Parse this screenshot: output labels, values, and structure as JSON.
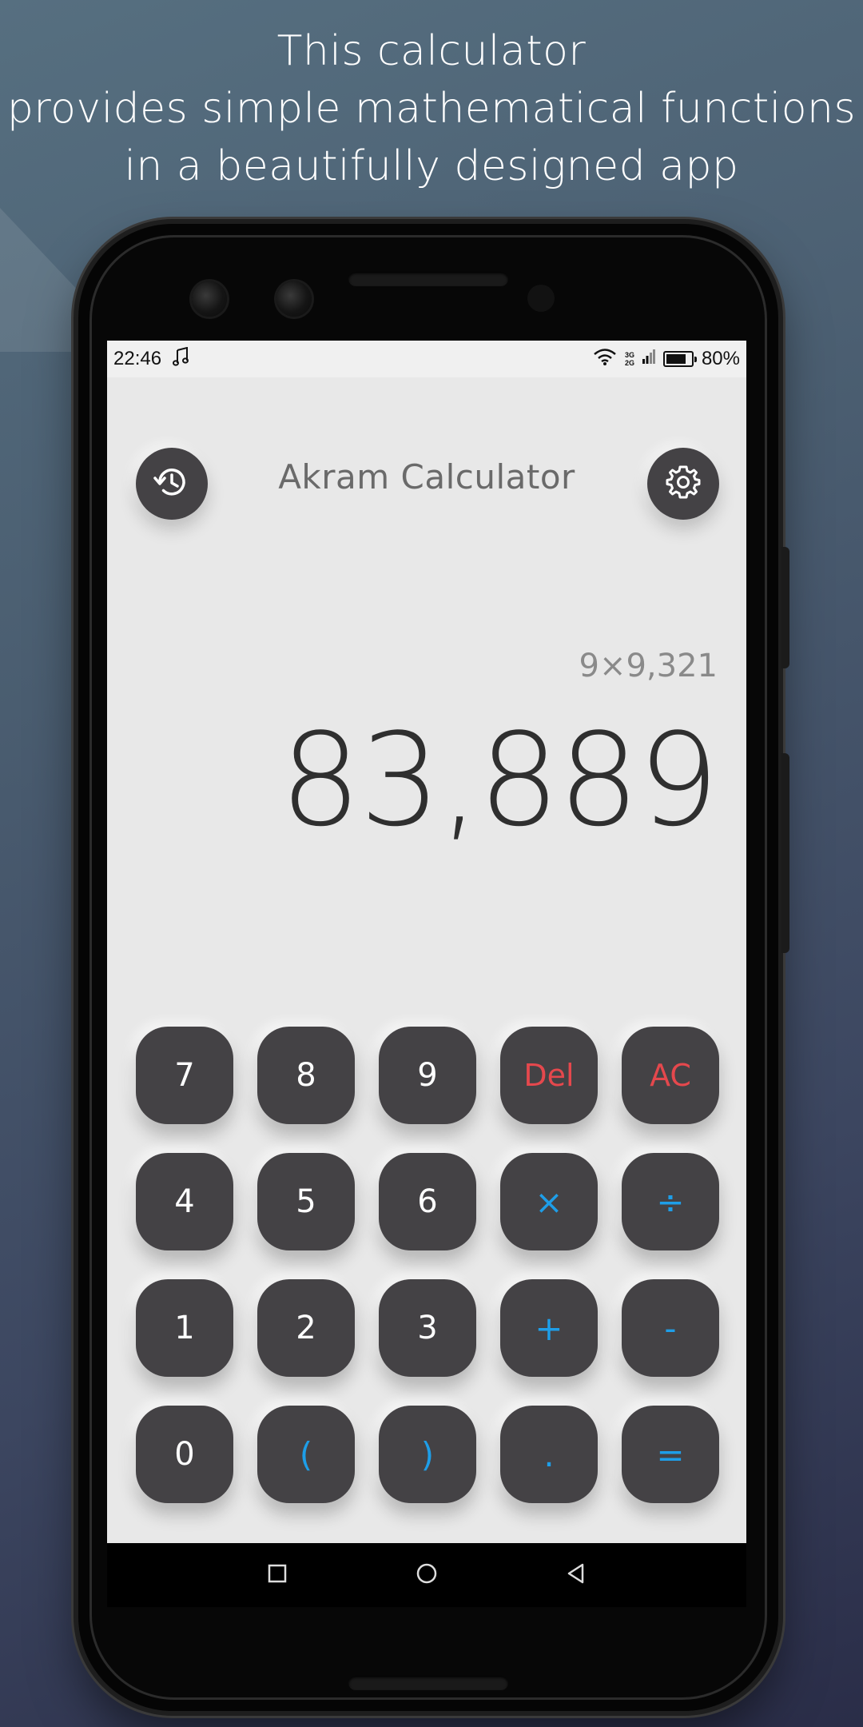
{
  "promo": {
    "line1": "This calculator",
    "line2": "provides simple mathematical functions",
    "line3": "in a beautifully designed app"
  },
  "status_bar": {
    "time": "22:46",
    "music_icon": "music-note-icon",
    "wifi_icon": "wifi-icon",
    "signal_top": "3G",
    "signal_bottom": "2G",
    "battery_percent": "80%",
    "battery_level": 0.8
  },
  "header": {
    "title": "Akram Calculator",
    "history_icon": "history-icon",
    "settings_icon": "gear-icon"
  },
  "display": {
    "expression": "9×9,321",
    "result": "83,889"
  },
  "keypad": {
    "rows": [
      [
        {
          "label": "7"
        },
        {
          "label": "8"
        },
        {
          "label": "9"
        },
        {
          "label": "Del"
        },
        {
          "label": "AC"
        }
      ],
      [
        {
          "label": "4"
        },
        {
          "label": "5"
        },
        {
          "label": "6"
        },
        {
          "label": "×"
        },
        {
          "label": "÷"
        }
      ],
      [
        {
          "label": "1"
        },
        {
          "label": "2"
        },
        {
          "label": "3"
        },
        {
          "label": "+"
        },
        {
          "label": "-"
        }
      ],
      [
        {
          "label": "0"
        },
        {
          "label": "("
        },
        {
          "label": ")"
        },
        {
          "label": "."
        },
        {
          "label": "="
        }
      ]
    ]
  },
  "nav_bar": {
    "recents_icon": "square-recents-icon",
    "home_icon": "circle-home-icon",
    "back_icon": "triangle-back-icon"
  },
  "colors": {
    "key_bg": "#444245",
    "key_text": "#ffffff",
    "danger": "#e5484d",
    "operator": "#1e9ee8",
    "screen_bg": "#e8e8e8"
  }
}
